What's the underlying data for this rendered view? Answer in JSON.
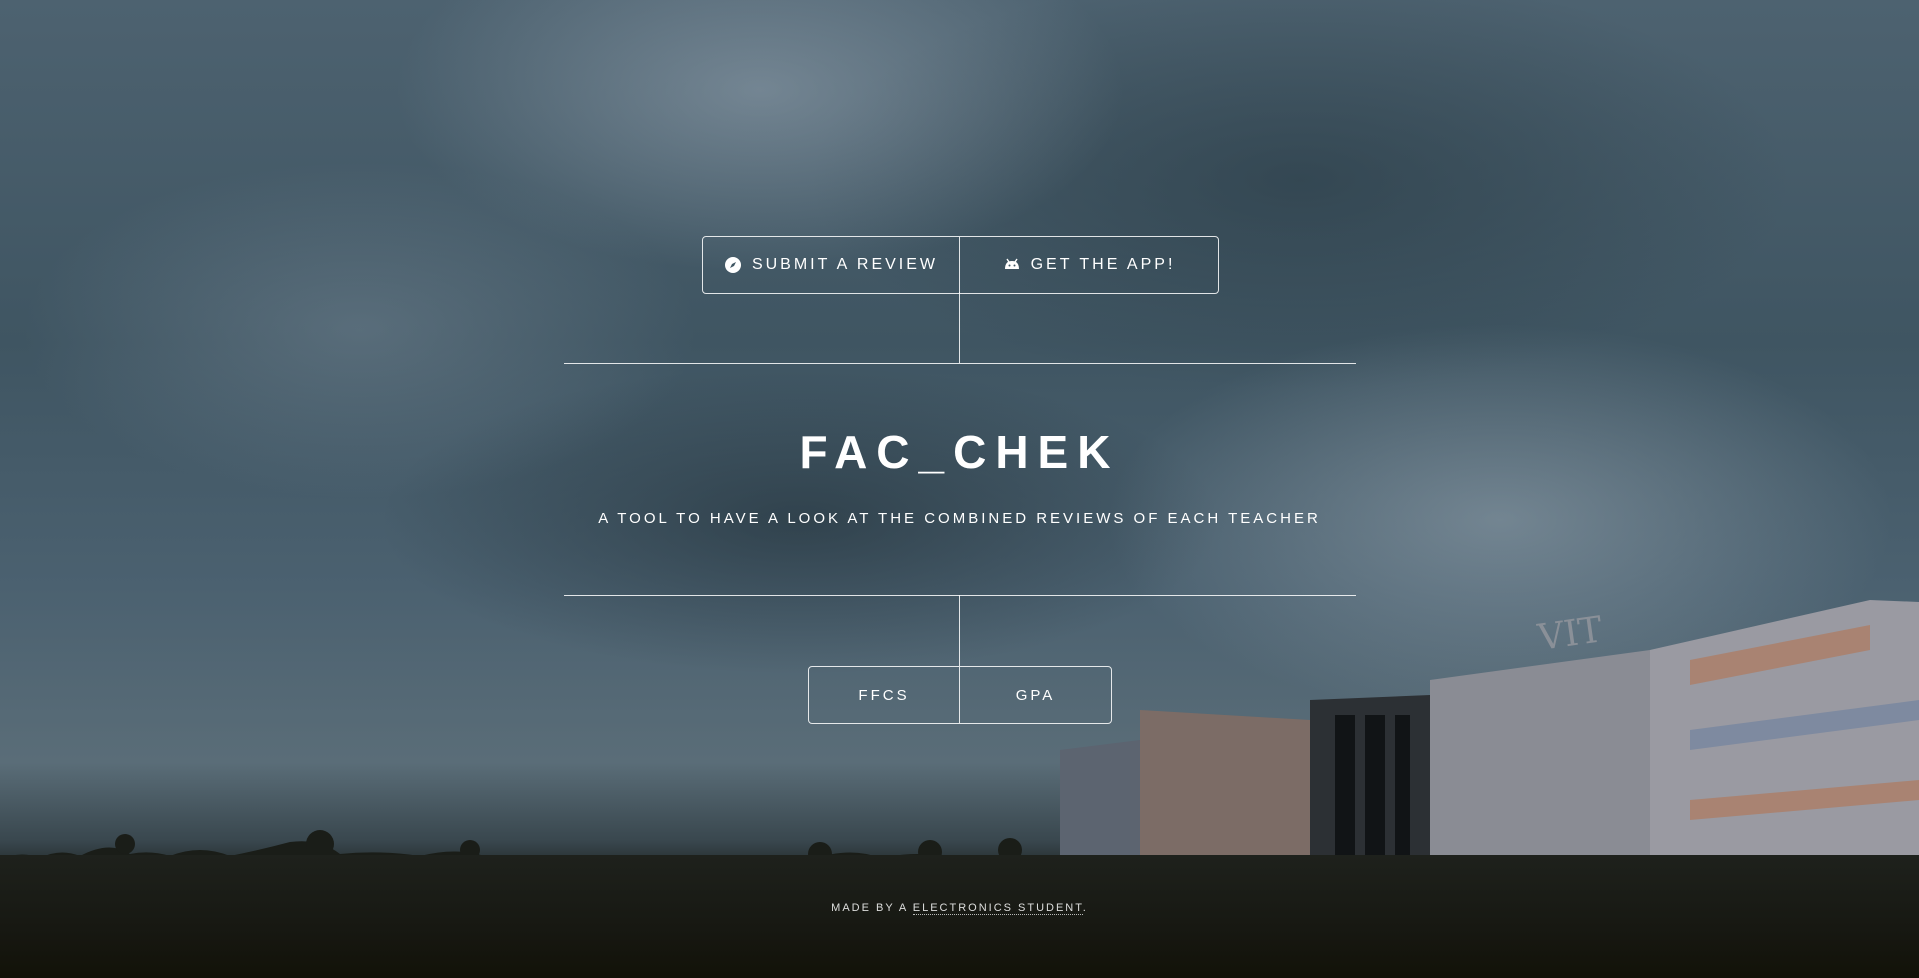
{
  "top_buttons": {
    "submit_label": "Submit a Review",
    "submit_icon": "compass-icon",
    "app_label": "Get the App!",
    "app_icon": "android-icon"
  },
  "header": {
    "title": "FAC_CHEK",
    "subtitle": "A tool to have a look at the combined reviews of each teacher"
  },
  "bottom_buttons": {
    "ffcs_label": "FFCS",
    "gpa_label": "GPA"
  },
  "footer": {
    "prefix": "Made by a ",
    "link_text": "Electronics Student",
    "suffix": "."
  },
  "background": {
    "sign_text": "VIT"
  },
  "colors": {
    "text": "#ffffff",
    "line": "#ffffff"
  }
}
